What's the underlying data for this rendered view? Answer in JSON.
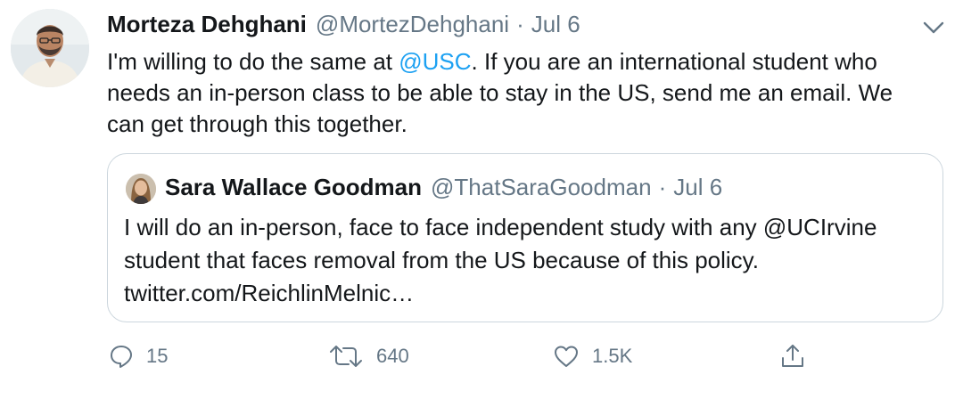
{
  "tweet": {
    "author_name": "Morteza Dehghani",
    "author_handle": "@MortezDehghani",
    "separator": "·",
    "date": "Jul 6",
    "text_parts": [
      "I'm willing to do the same at ",
      "@USC",
      ". If you are an international student who needs an in-person class to be able to stay in the US, send me an email. We can get through this together."
    ],
    "icons": {
      "caret": "chevron-down-icon"
    }
  },
  "quoted_tweet": {
    "author_name": "Sara Wallace Goodman",
    "author_handle": "@ThatSaraGoodman",
    "separator": "·",
    "date": "Jul 6",
    "text": "I will do an in-person, face to face independent study with any @UCIrvine student that faces removal from the US because of this policy. twitter.com/ReichlinMelnic…"
  },
  "actions": {
    "reply_count": "15",
    "retweet_count": "640",
    "like_count": "1.5K",
    "icons": [
      "reply-icon",
      "retweet-icon",
      "like-icon",
      "share-icon"
    ]
  },
  "colors": {
    "text": "#14171a",
    "secondary": "#657786",
    "link": "#1da1f2",
    "border": "#ccd6dd"
  }
}
